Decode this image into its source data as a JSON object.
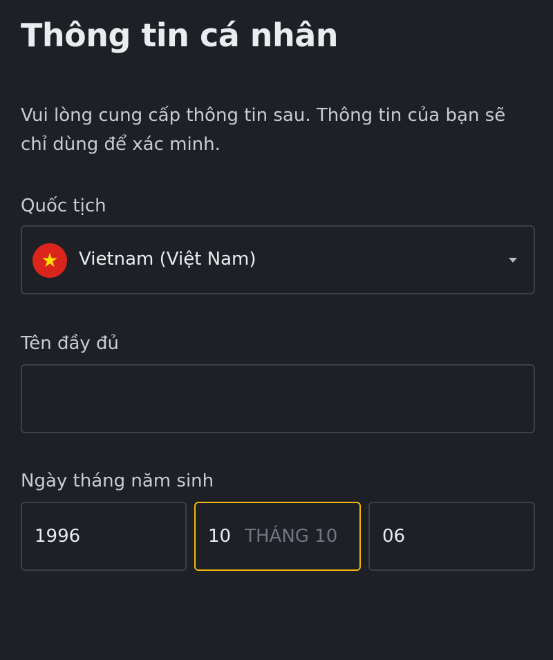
{
  "header": {
    "title": "Thông tin cá nhân",
    "description": "Vui lòng cung cấp thông tin sau. Thông tin của bạn sẽ chỉ dùng để xác minh."
  },
  "nationality": {
    "label": "Quốc tịch",
    "value": "Vietnam (Việt Nam)",
    "flag_icon": "vietnam-flag-icon",
    "flag_color": "#da251d",
    "star_glyph": "★",
    "star_color": "#ffde00"
  },
  "full_name": {
    "label": "Tên đầy đủ",
    "value": "",
    "placeholder": ""
  },
  "date_of_birth": {
    "label": "Ngày tháng năm sinh",
    "year": "1996",
    "month": "10",
    "month_hint": "THÁNG 10",
    "day": "06"
  },
  "colors": {
    "background": "#1e2026",
    "border": "#3a3f49",
    "focus_border": "#f0b90b",
    "text": "#eaecef",
    "muted_text": "#6f7683"
  }
}
